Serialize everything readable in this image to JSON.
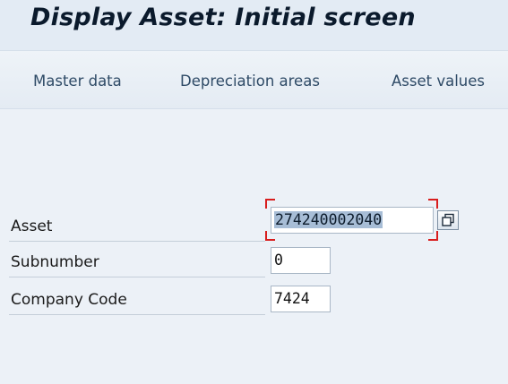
{
  "header": {
    "title": "Display Asset: Initial screen"
  },
  "toolbar": {
    "master_data": "Master data",
    "depreciation_areas": "Depreciation areas",
    "asset_values": "Asset values"
  },
  "form": {
    "asset": {
      "label": "Asset",
      "value": "274240002040"
    },
    "subnumber": {
      "label": "Subnumber",
      "value": "0"
    },
    "company_code": {
      "label": "Company Code",
      "value": "7424"
    }
  },
  "icons": {
    "matchcode": "copy-windows-icon"
  },
  "colors": {
    "focus_frame": "#d81e1e",
    "selection": "#a7bdd6"
  }
}
